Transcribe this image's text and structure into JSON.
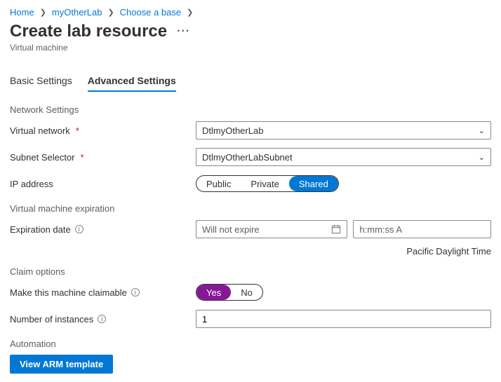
{
  "breadcrumb": {
    "items": [
      "Home",
      "myOtherLab",
      "Choose a base"
    ]
  },
  "header": {
    "title": "Create lab resource",
    "subtitle": "Virtual machine"
  },
  "tabs": {
    "basic": "Basic Settings",
    "advanced": "Advanced Settings"
  },
  "sections": {
    "network": "Network Settings",
    "expiration": "Virtual machine expiration",
    "claim": "Claim options",
    "automation": "Automation"
  },
  "form": {
    "vnet_label": "Virtual network",
    "vnet_value": "DtlmyOtherLab",
    "subnet_label": "Subnet Selector",
    "subnet_value": "DtlmyOtherLabSubnet",
    "ip_label": "IP address",
    "ip_options": {
      "public": "Public",
      "private": "Private",
      "shared": "Shared"
    },
    "exp_date_label": "Expiration date",
    "exp_date_placeholder": "Will not expire",
    "exp_time_placeholder": "h:mm:ss A",
    "timezone": "Pacific Daylight Time",
    "claim_label": "Make this machine claimable",
    "claim_yes": "Yes",
    "claim_no": "No",
    "instances_label": "Number of instances",
    "instances_value": "1",
    "arm_button": "View ARM template"
  }
}
